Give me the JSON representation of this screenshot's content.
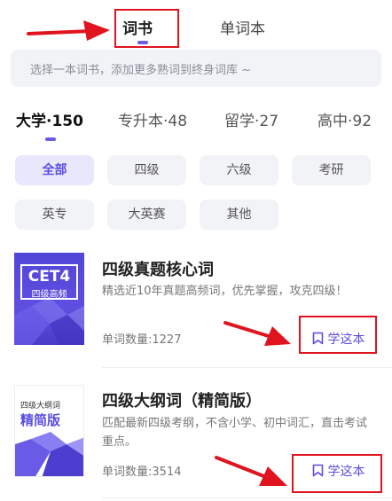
{
  "top_tabs": {
    "active": "词书",
    "inactive": "单词本"
  },
  "search": {
    "text": "选择一本词书，添加更多熟词到终身词库 ~"
  },
  "category_tabs": [
    {
      "label": "大学·150"
    },
    {
      "label": "专升本·48"
    },
    {
      "label": "留学·27"
    },
    {
      "label": "高中·92"
    }
  ],
  "filter_chips": [
    {
      "label": "全部"
    },
    {
      "label": "四级"
    },
    {
      "label": "六级"
    },
    {
      "label": "考研"
    },
    {
      "label": "英专"
    },
    {
      "label": "大英赛"
    },
    {
      "label": "其他"
    }
  ],
  "books": [
    {
      "cover_main": "CET4",
      "cover_sub": "四级高频",
      "title": "四级真题核心词",
      "description": "精选近10年真题高频词，优先掌握，攻克四级！",
      "count": "单词数量:1227",
      "action": "学这本"
    },
    {
      "cover_main": "四级大纲词",
      "cover_sub": "精简版",
      "title": "四级大纲词（精简版）",
      "description": "匹配最新四级考纲，不含小学、初中词汇，直击考试重点。",
      "count": "单词数量:3514",
      "action": "学这本"
    }
  ],
  "colors": {
    "accent": "#5b4ee0",
    "annotation": "#e0141e"
  }
}
